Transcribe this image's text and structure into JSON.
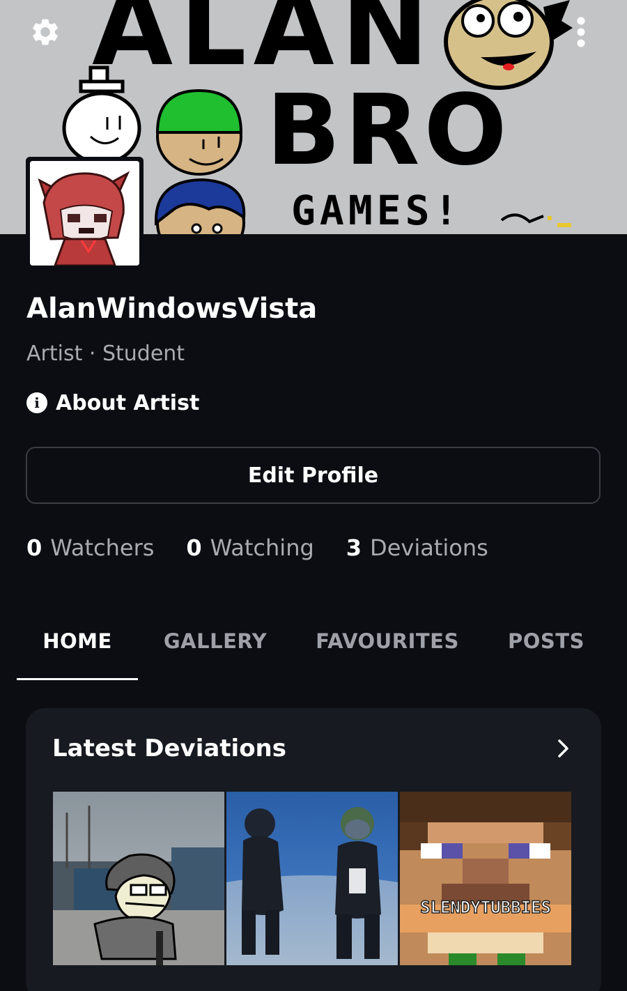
{
  "banner": {
    "line1": "ALAN",
    "line2": "BRO",
    "line3": "GAMES!"
  },
  "profile": {
    "username": "AlanWindowsVista",
    "subtitle": "Artist · Student",
    "about_label": "About Artist",
    "edit_label": "Edit Profile"
  },
  "stats": [
    {
      "count": "0",
      "label": "Watchers"
    },
    {
      "count": "0",
      "label": "Watching"
    },
    {
      "count": "3",
      "label": "Deviations"
    }
  ],
  "tabs": [
    {
      "label": "HOME",
      "active": true
    },
    {
      "label": "GALLERY",
      "active": false
    },
    {
      "label": "FAVOURITES",
      "active": false
    },
    {
      "label": "POSTS",
      "active": false
    }
  ],
  "latest": {
    "title": "Latest Deviations",
    "thumbs": [
      {
        "caption": ""
      },
      {
        "caption": ""
      },
      {
        "caption": "SLENDYTUBBIES"
      }
    ]
  },
  "colors": {
    "background": "#0b0d12",
    "card": "#171a20",
    "muted_text": "#a9abb1",
    "banner_bg": "#c3c4c6"
  },
  "icons": {
    "settings": "gear-icon",
    "more": "more-vertical-icon",
    "about": "info-icon",
    "see_all": "chevron-right-icon"
  }
}
